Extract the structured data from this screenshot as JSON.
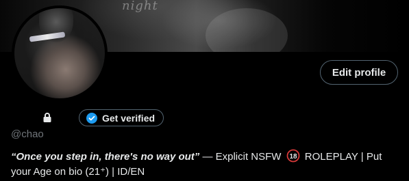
{
  "banner": {
    "watermark": "night"
  },
  "profile": {
    "edit_label": "Edit profile",
    "verify_label": "Get verified",
    "handle": "@chao",
    "bio": {
      "quote": "“Once you step in, there's no way out”",
      "part1": " — Explicit NSFW ",
      "nsfw_badge": "18",
      "part2": " ROLEPLAY |  Put your Age on bio (21⁺)  |  ID/EN"
    }
  },
  "colors": {
    "background": "#000000",
    "text": "#e7e9ea",
    "muted": "#71767b",
    "border": "#536471",
    "verified_blue": "#1d9bf0",
    "nsfw_red": "#d83a3a"
  },
  "icons": {
    "lock": "lock-icon",
    "verified": "verified-badge-icon",
    "nsfw": "eighteen-plus-icon"
  }
}
